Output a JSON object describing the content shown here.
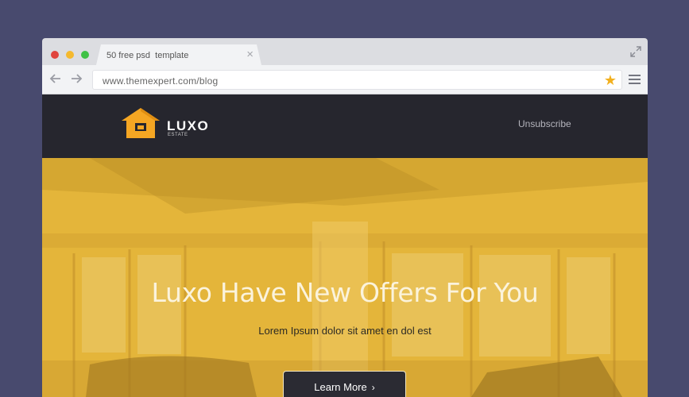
{
  "browser": {
    "tab_title": "50 free psd  template",
    "tab_close_glyph": "×",
    "url": "www.themexpert.com/blog",
    "star_glyph": "★",
    "icons": [
      "close-dot-icon",
      "minimize-dot-icon",
      "maximize-dot-icon",
      "tab-close-icon",
      "expand-icon",
      "back-arrow-icon",
      "forward-arrow-icon",
      "bookmark-star-icon",
      "menu-icon"
    ]
  },
  "site": {
    "logo": {
      "name": "LUXO",
      "sub": "ESTATE",
      "icon": "house-icon",
      "color": "#f5a623"
    },
    "nav": {
      "unsubscribe": "Unsubscribe"
    }
  },
  "hero": {
    "title": "Luxo Have New Offers For You",
    "subtitle": "Lorem Ipsum dolor sit amet en dol est",
    "cta_label": "Learn More",
    "cta_chevron": "›",
    "overlay_color": "#e6b83c"
  },
  "colors": {
    "page_bg": "#484a6e",
    "header_bg": "#26262e",
    "accent": "#f2b01e"
  }
}
